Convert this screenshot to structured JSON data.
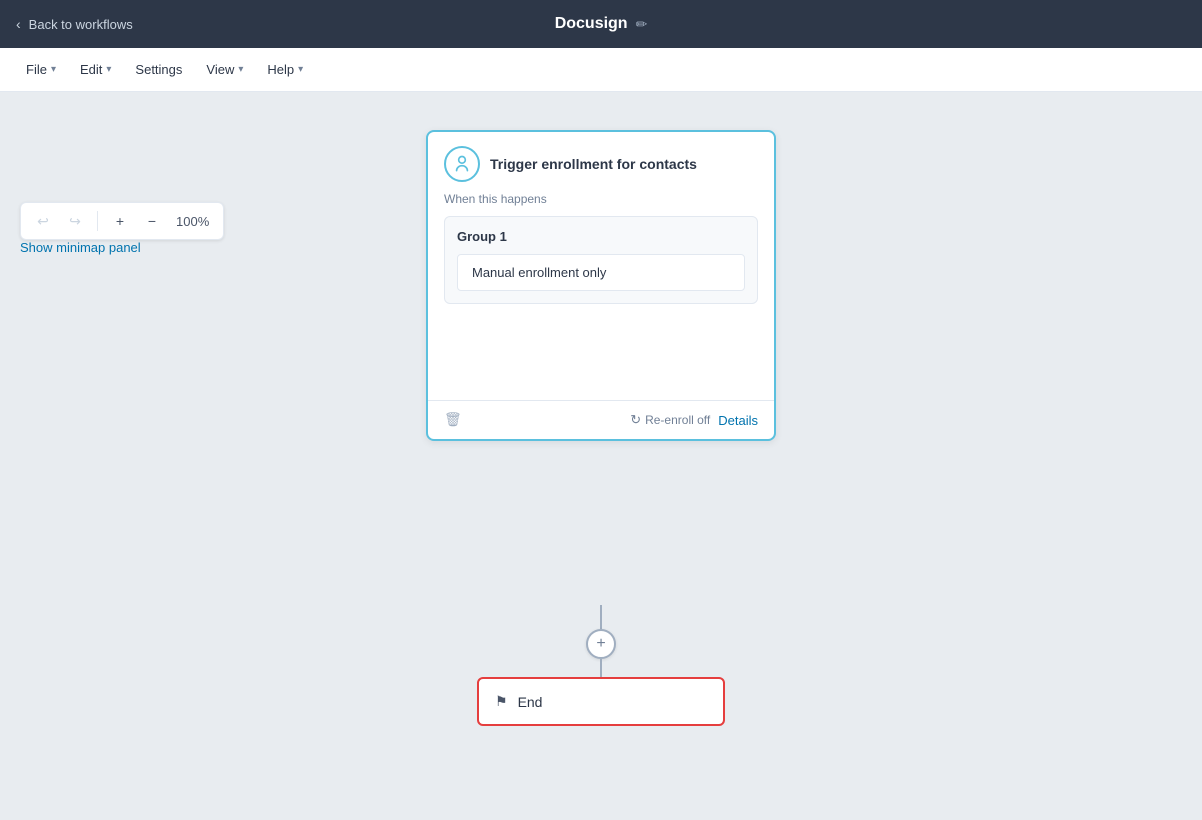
{
  "topbar": {
    "back_label": "Back to workflows",
    "workflow_title": "Docusign",
    "edit_icon": "✏"
  },
  "menubar": {
    "items": [
      {
        "label": "File",
        "has_dropdown": true
      },
      {
        "label": "Edit",
        "has_dropdown": true
      },
      {
        "label": "Settings",
        "has_dropdown": false
      },
      {
        "label": "View",
        "has_dropdown": true
      },
      {
        "label": "Help",
        "has_dropdown": true
      }
    ]
  },
  "toolbar": {
    "undo_label": "↩",
    "redo_label": "↪",
    "zoom_in_label": "+",
    "zoom_out_label": "−",
    "zoom_level": "100%"
  },
  "minimap": {
    "label": "Show minimap panel"
  },
  "trigger_card": {
    "title": "Trigger enrollment for contacts",
    "when_label": "When this happens",
    "group_title": "Group 1",
    "enrollment_text": "Manual enrollment only",
    "reenroll_label": "Re-enroll off",
    "details_label": "Details"
  },
  "connector": {
    "add_icon": "+"
  },
  "end_card": {
    "label": "End"
  },
  "colors": {
    "trigger_border": "#5bc0de",
    "end_border": "#e53e3e",
    "topbar_bg": "#2d3748",
    "canvas_bg": "#e8ecf0"
  }
}
